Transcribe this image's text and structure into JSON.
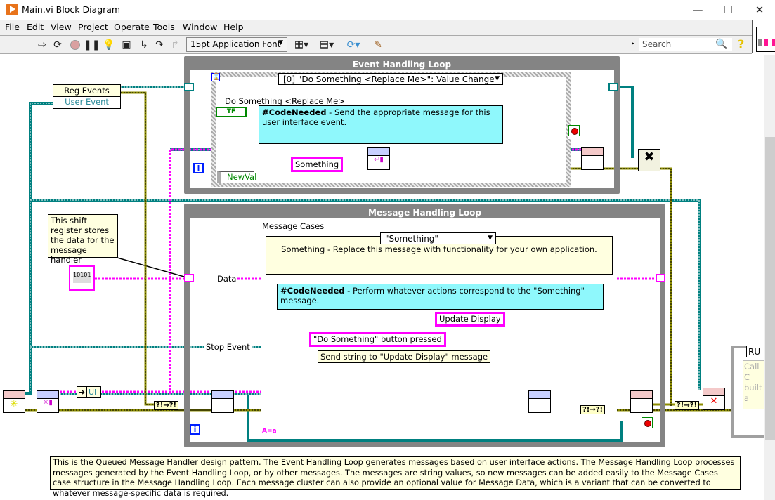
{
  "window": {
    "title": "Main.vi Block Diagram",
    "minimize_icon": "minimize-icon",
    "maximize_icon": "maximize-icon",
    "close_icon": "close-icon"
  },
  "menu": [
    "File",
    "Edit",
    "View",
    "Project",
    "Operate",
    "Tools",
    "Window",
    "Help"
  ],
  "toolbar": {
    "icons": [
      "run-arrow-icon",
      "run-continuously-icon",
      "abort-icon",
      "pause-icon",
      "highlight-execution-icon",
      "retain-wire-values-icon",
      "step-into-icon",
      "step-over-icon",
      "step-out-icon"
    ],
    "font": "15pt Application Font",
    "layout_icons": [
      "align-objects-icon",
      "distribute-objects-icon",
      "reorder-icon",
      "cleanup-diagram-icon"
    ],
    "search_placeholder": "Search",
    "help_icon": "help-icon"
  },
  "diagram": {
    "event_loop": {
      "title": "Event Handling Loop",
      "event_selector": "[0] \"Do Something <Replace Me>\": Value Change",
      "control_label": "Do Something <Replace Me>",
      "bool_terminal": "TF",
      "comment_bold": "#CodeNeeded",
      "comment_text": " - Send the appropriate message for this user interface event.",
      "string_constant": "Something",
      "event_data": "NewVal"
    },
    "reg_events": {
      "title": "Reg Events",
      "item": "User Event"
    },
    "shift_register_note": "This shift register stores the data for the message handler",
    "message_loop": {
      "title": "Message Handling Loop",
      "case_label": "Message Cases",
      "case_selector": "\"Something\"",
      "case_description": "Something - Replace this message with functionality for your own application.",
      "data_label": "Data",
      "stop_event_label": "Stop Event",
      "comment_bold": "#CodeNeeded",
      "comment_text": " - Perform whatever actions correspond to the \"Something\" message.",
      "update_display": "Update Display",
      "button_pressed": "\"Do Something\" button pressed",
      "send_note": "Send string to \"Update Display\" message",
      "case_insensitive": "A=a"
    },
    "ui_constant": "UI",
    "right_case": {
      "selector": "RU",
      "comment": "Call C built a"
    },
    "iteration_label": "i"
  },
  "bottom_comment": "This is the Queued Message Handler design pattern. The Event Handling Loop generates messages based on user interface actions. The Message Handling Loop processes messages generated by the Event Handling Loop, or by other messages.  The messages are string values, so new messages can be added easily to the Message Cases case structure in the Message Handling Loop.  Each message cluster can also provide an optional value for Message Data, which is a variant that can be converted to whatever message-specific data is required.",
  "colors": {
    "string_wire": "#ff00ff",
    "refnum_wire": "#008080",
    "error_wire": "#8c8c00",
    "loop_frame": "#848484",
    "comment_yellow": "#ffffe0",
    "code_needed_cyan": "#8ff8fc",
    "accent_orange": "#e8731b"
  }
}
